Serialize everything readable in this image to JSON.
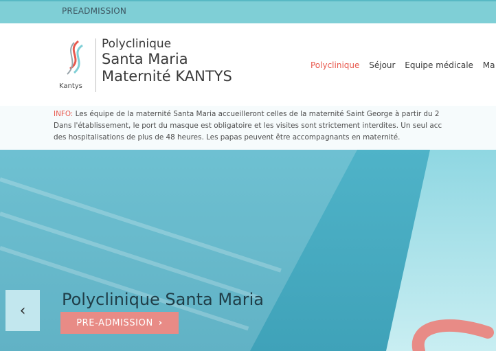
{
  "topbar": {
    "preadmission": "PREADMISSION"
  },
  "header": {
    "logo_text": "Kantys",
    "brand_line1": "Polyclinique",
    "brand_line2": "Santa Maria",
    "brand_line3": "Maternité KANTYS",
    "nav": [
      {
        "label": "Polyclinique",
        "active": true
      },
      {
        "label": "Séjour",
        "active": false
      },
      {
        "label": "Equipe médicale",
        "active": false
      },
      {
        "label": "Ma",
        "active": false
      }
    ]
  },
  "info": {
    "tag": "INFO:",
    "line1": " Les équipe de la maternité Santa Maria accueilleront celles de la maternité Saint George à partir du 2",
    "line2": "Dans l'établissement, le port du masque est obligatoire et les visites sont strictement interdites. Un seul acc",
    "line3": "des hospitalisations de plus de 48 heures. Les papas peuvent être accompagnants en maternité."
  },
  "hero": {
    "title": "Polyclinique Santa Maria",
    "button_label": "PRE-ADMISSION",
    "button_chevron": "›",
    "prev_arrow": "‹"
  },
  "colors": {
    "topbar": "#7fcfd6",
    "accent": "#e8594e",
    "button": "#e88b86",
    "hero": "#4fb3c8"
  }
}
